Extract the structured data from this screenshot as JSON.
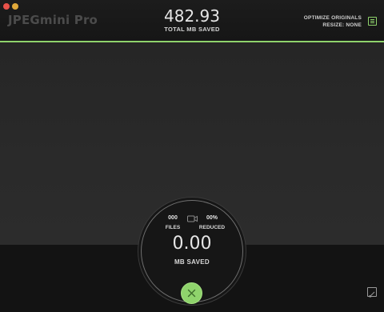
{
  "app": {
    "title": "JPEGmini Pro"
  },
  "header": {
    "total_value": "482.93",
    "total_label": "TOTAL MB SAVED",
    "options": [
      "OPTIMIZE ORIGINALS",
      "RESIZE: NONE"
    ]
  },
  "dial": {
    "files_count": "000",
    "files_label": "FILES",
    "reduced_pct": "00%",
    "reduced_label": "REDUCED",
    "saved_value": "0.00",
    "saved_label": "MB SAVED"
  },
  "icons": {
    "menu": "menu-icon",
    "camera": "camera-icon",
    "cancel": "close-icon",
    "resize": "resize-grip-icon"
  },
  "colors": {
    "accent": "#8fd36c",
    "close_light": "#e8524a",
    "minimize_light": "#e0a93a"
  }
}
